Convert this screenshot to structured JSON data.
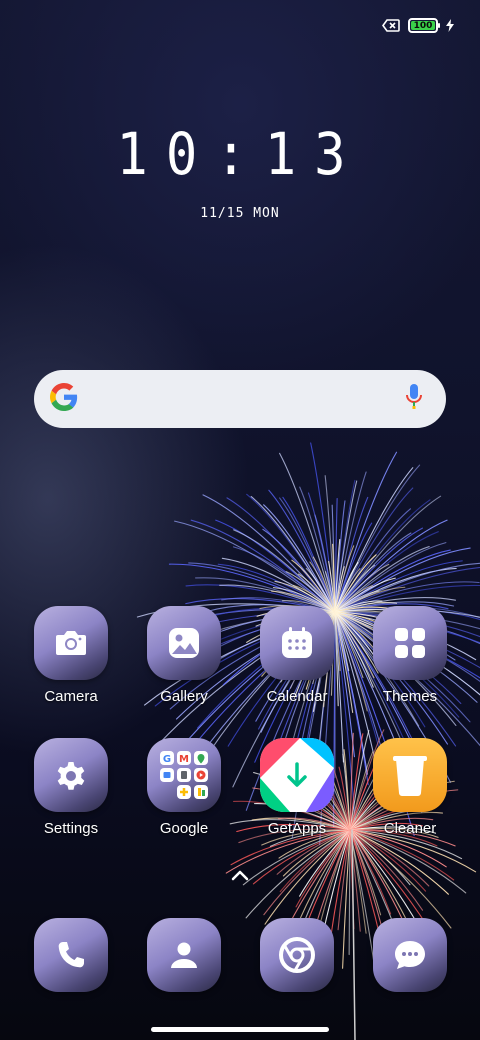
{
  "status_bar": {
    "battery_level": "100"
  },
  "lock": {
    "time": "10:13",
    "date": "11/15 MON"
  },
  "search": {
    "google_icon": "google-g-icon",
    "mic_icon": "microphone-icon"
  },
  "apps": [
    {
      "label": "Camera",
      "icon": "camera-icon"
    },
    {
      "label": "Gallery",
      "icon": "gallery-icon"
    },
    {
      "label": "Calendar",
      "icon": "calendar-icon"
    },
    {
      "label": "Themes",
      "icon": "themes-icon"
    },
    {
      "label": "Settings",
      "icon": "gear-icon"
    },
    {
      "label": "Google",
      "icon": "google-folder-icon"
    },
    {
      "label": "GetApps",
      "icon": "getapps-icon"
    },
    {
      "label": "Cleaner",
      "icon": "trash-icon"
    }
  ],
  "dock": [
    {
      "icon": "phone-icon"
    },
    {
      "icon": "contacts-icon"
    },
    {
      "icon": "chrome-icon"
    },
    {
      "icon": "messages-icon"
    }
  ],
  "colors": {
    "icon_gradient_top": "#b9b1e0",
    "icon_gradient_bottom": "#2b2a44",
    "battery_fill": "#3ad14a",
    "cleaner": "#f5a623",
    "search_bg": "#eceef3"
  }
}
